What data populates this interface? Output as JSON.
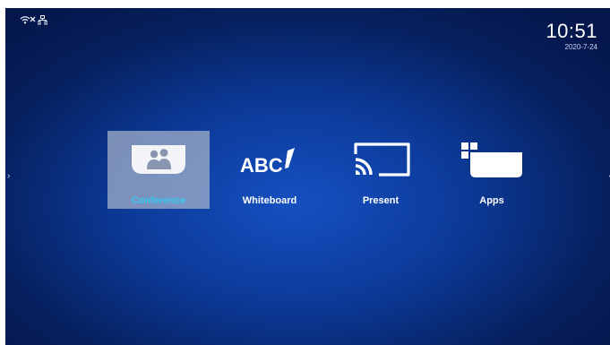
{
  "status": {
    "wifi_icon": "wifi-disconnected-icon",
    "network_icon": "ethernet-icon"
  },
  "clock": {
    "time": "10:51",
    "date": "2020-7-24"
  },
  "nav": {
    "left_arrow": "›",
    "right_arrow": "‹"
  },
  "menu": {
    "selected_label_color": "#34c8f0",
    "items": [
      {
        "label": "Conference",
        "icon": "conference-icon",
        "selected": true
      },
      {
        "label": "Whiteboard",
        "icon": "whiteboard-abc-icon",
        "selected": false
      },
      {
        "label": "Present",
        "icon": "cast-icon",
        "selected": false
      },
      {
        "label": "Apps",
        "icon": "apps-icon",
        "selected": false
      }
    ]
  }
}
